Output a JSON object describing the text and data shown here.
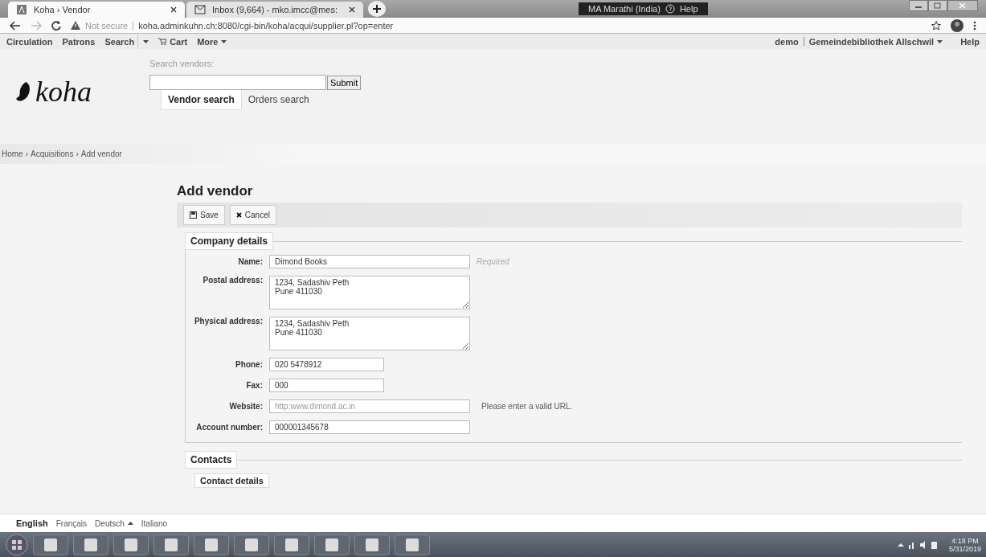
{
  "browser": {
    "tabs": [
      {
        "title": "Koha › Vendor",
        "selected": true
      },
      {
        "title": "Inbox (9,664) - mko.imcc@mes:",
        "selected": false
      }
    ],
    "ime": {
      "language": "MA Marathi (India)",
      "help": "Help"
    },
    "security": "Not secure",
    "url": "koha.adminkuhn.ch:8080/cgi-bin/koha/acqui/supplier.pl?op=enter"
  },
  "nav": {
    "items": [
      "Circulation",
      "Patrons",
      "Search",
      "Cart",
      "More"
    ],
    "user": "demo",
    "library": "Gemeindebibliothek Allschwil",
    "help": "Help"
  },
  "header": {
    "logo": "koha",
    "search_label": "Search vendors:",
    "submit": "Submit",
    "tabs": [
      {
        "label": "Vendor search",
        "selected": true
      },
      {
        "label": "Orders search",
        "selected": false
      }
    ]
  },
  "breadcrumbs": {
    "separator": "›",
    "items": [
      "Home",
      "Acquisitions",
      "Add vendor"
    ]
  },
  "page": {
    "title": "Add vendor",
    "buttons": [
      {
        "kind": "save",
        "label": "Save"
      },
      {
        "kind": "cancel",
        "label": "Cancel"
      }
    ],
    "company_legend": "Company details",
    "fields": [
      {
        "kind": "text",
        "label": "Name:",
        "value": "Dimond Books",
        "note": {
          "kind": "required",
          "text": "Required"
        }
      },
      {
        "kind": "textarea",
        "label": "Postal address:",
        "value": "1234, Sadashiv Peth\nPune 411030"
      },
      {
        "kind": "textarea",
        "label": "Physical address:",
        "value": "1234, Sadashiv Peth\nPune 411030"
      },
      {
        "kind": "short_text",
        "label": "Phone:",
        "value": "020 5478912"
      },
      {
        "kind": "short_text",
        "label": "Fax:",
        "value": "000"
      },
      {
        "kind": "text",
        "label": "Website:",
        "placeholder": "http:www.dimond.ac.in",
        "note": {
          "kind": "error",
          "text": "Please enter a valid URL."
        }
      },
      {
        "kind": "text",
        "label": "Account number:",
        "value": "000001345678"
      }
    ],
    "contacts_legend": "Contacts",
    "contact_details_legend": "Contact details"
  },
  "languages": [
    {
      "label": "English",
      "selected": true
    },
    {
      "label": "Français",
      "selected": false
    },
    {
      "label": "Deutsch",
      "selected": false,
      "menu": true
    },
    {
      "label": "Italiano",
      "selected": false
    }
  ],
  "taskbar": {
    "time": "4:18 PM",
    "date": "5/31/2019"
  }
}
